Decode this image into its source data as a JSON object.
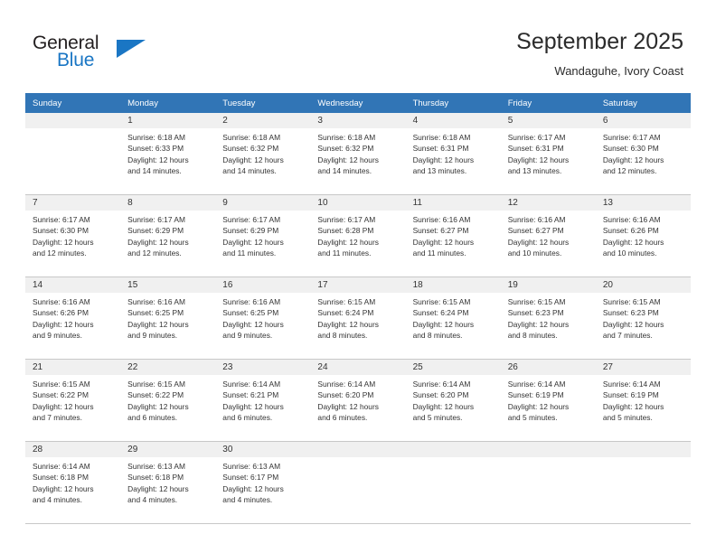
{
  "brand": {
    "name_top": "General",
    "name_bottom": "Blue",
    "accent_color": "#1a76c4",
    "triangle_icon": "brand-triangle-icon"
  },
  "header": {
    "title": "September 2025",
    "subtitle": "Wandaguhe, Ivory Coast"
  },
  "theme": {
    "header_row_bg": "#3175b6",
    "daynum_bg": "#f0f0f0",
    "grid_line": "#c8c8c8",
    "text": "#333333"
  },
  "weekdays": [
    "Sunday",
    "Monday",
    "Tuesday",
    "Wednesday",
    "Thursday",
    "Friday",
    "Saturday"
  ],
  "weeks": [
    [
      {
        "day": "",
        "lines": []
      },
      {
        "day": "1",
        "lines": [
          "Sunrise: 6:18 AM",
          "Sunset: 6:33 PM",
          "Daylight: 12 hours",
          "and 14 minutes."
        ]
      },
      {
        "day": "2",
        "lines": [
          "Sunrise: 6:18 AM",
          "Sunset: 6:32 PM",
          "Daylight: 12 hours",
          "and 14 minutes."
        ]
      },
      {
        "day": "3",
        "lines": [
          "Sunrise: 6:18 AM",
          "Sunset: 6:32 PM",
          "Daylight: 12 hours",
          "and 14 minutes."
        ]
      },
      {
        "day": "4",
        "lines": [
          "Sunrise: 6:18 AM",
          "Sunset: 6:31 PM",
          "Daylight: 12 hours",
          "and 13 minutes."
        ]
      },
      {
        "day": "5",
        "lines": [
          "Sunrise: 6:17 AM",
          "Sunset: 6:31 PM",
          "Daylight: 12 hours",
          "and 13 minutes."
        ]
      },
      {
        "day": "6",
        "lines": [
          "Sunrise: 6:17 AM",
          "Sunset: 6:30 PM",
          "Daylight: 12 hours",
          "and 12 minutes."
        ]
      }
    ],
    [
      {
        "day": "7",
        "lines": [
          "Sunrise: 6:17 AM",
          "Sunset: 6:30 PM",
          "Daylight: 12 hours",
          "and 12 minutes."
        ]
      },
      {
        "day": "8",
        "lines": [
          "Sunrise: 6:17 AM",
          "Sunset: 6:29 PM",
          "Daylight: 12 hours",
          "and 12 minutes."
        ]
      },
      {
        "day": "9",
        "lines": [
          "Sunrise: 6:17 AM",
          "Sunset: 6:29 PM",
          "Daylight: 12 hours",
          "and 11 minutes."
        ]
      },
      {
        "day": "10",
        "lines": [
          "Sunrise: 6:17 AM",
          "Sunset: 6:28 PM",
          "Daylight: 12 hours",
          "and 11 minutes."
        ]
      },
      {
        "day": "11",
        "lines": [
          "Sunrise: 6:16 AM",
          "Sunset: 6:27 PM",
          "Daylight: 12 hours",
          "and 11 minutes."
        ]
      },
      {
        "day": "12",
        "lines": [
          "Sunrise: 6:16 AM",
          "Sunset: 6:27 PM",
          "Daylight: 12 hours",
          "and 10 minutes."
        ]
      },
      {
        "day": "13",
        "lines": [
          "Sunrise: 6:16 AM",
          "Sunset: 6:26 PM",
          "Daylight: 12 hours",
          "and 10 minutes."
        ]
      }
    ],
    [
      {
        "day": "14",
        "lines": [
          "Sunrise: 6:16 AM",
          "Sunset: 6:26 PM",
          "Daylight: 12 hours",
          "and 9 minutes."
        ]
      },
      {
        "day": "15",
        "lines": [
          "Sunrise: 6:16 AM",
          "Sunset: 6:25 PM",
          "Daylight: 12 hours",
          "and 9 minutes."
        ]
      },
      {
        "day": "16",
        "lines": [
          "Sunrise: 6:16 AM",
          "Sunset: 6:25 PM",
          "Daylight: 12 hours",
          "and 9 minutes."
        ]
      },
      {
        "day": "17",
        "lines": [
          "Sunrise: 6:15 AM",
          "Sunset: 6:24 PM",
          "Daylight: 12 hours",
          "and 8 minutes."
        ]
      },
      {
        "day": "18",
        "lines": [
          "Sunrise: 6:15 AM",
          "Sunset: 6:24 PM",
          "Daylight: 12 hours",
          "and 8 minutes."
        ]
      },
      {
        "day": "19",
        "lines": [
          "Sunrise: 6:15 AM",
          "Sunset: 6:23 PM",
          "Daylight: 12 hours",
          "and 8 minutes."
        ]
      },
      {
        "day": "20",
        "lines": [
          "Sunrise: 6:15 AM",
          "Sunset: 6:23 PM",
          "Daylight: 12 hours",
          "and 7 minutes."
        ]
      }
    ],
    [
      {
        "day": "21",
        "lines": [
          "Sunrise: 6:15 AM",
          "Sunset: 6:22 PM",
          "Daylight: 12 hours",
          "and 7 minutes."
        ]
      },
      {
        "day": "22",
        "lines": [
          "Sunrise: 6:15 AM",
          "Sunset: 6:22 PM",
          "Daylight: 12 hours",
          "and 6 minutes."
        ]
      },
      {
        "day": "23",
        "lines": [
          "Sunrise: 6:14 AM",
          "Sunset: 6:21 PM",
          "Daylight: 12 hours",
          "and 6 minutes."
        ]
      },
      {
        "day": "24",
        "lines": [
          "Sunrise: 6:14 AM",
          "Sunset: 6:20 PM",
          "Daylight: 12 hours",
          "and 6 minutes."
        ]
      },
      {
        "day": "25",
        "lines": [
          "Sunrise: 6:14 AM",
          "Sunset: 6:20 PM",
          "Daylight: 12 hours",
          "and 5 minutes."
        ]
      },
      {
        "day": "26",
        "lines": [
          "Sunrise: 6:14 AM",
          "Sunset: 6:19 PM",
          "Daylight: 12 hours",
          "and 5 minutes."
        ]
      },
      {
        "day": "27",
        "lines": [
          "Sunrise: 6:14 AM",
          "Sunset: 6:19 PM",
          "Daylight: 12 hours",
          "and 5 minutes."
        ]
      }
    ],
    [
      {
        "day": "28",
        "lines": [
          "Sunrise: 6:14 AM",
          "Sunset: 6:18 PM",
          "Daylight: 12 hours",
          "and 4 minutes."
        ]
      },
      {
        "day": "29",
        "lines": [
          "Sunrise: 6:13 AM",
          "Sunset: 6:18 PM",
          "Daylight: 12 hours",
          "and 4 minutes."
        ]
      },
      {
        "day": "30",
        "lines": [
          "Sunrise: 6:13 AM",
          "Sunset: 6:17 PM",
          "Daylight: 12 hours",
          "and 4 minutes."
        ]
      },
      {
        "day": "",
        "lines": []
      },
      {
        "day": "",
        "lines": []
      },
      {
        "day": "",
        "lines": []
      },
      {
        "day": "",
        "lines": []
      }
    ]
  ]
}
